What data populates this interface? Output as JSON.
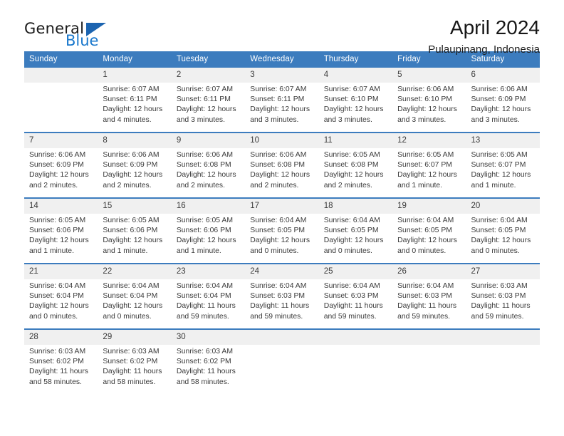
{
  "brand": {
    "name_part1": "General",
    "name_part2": "Blue",
    "triangle_icon": "triangle-icon",
    "colors": {
      "dark": "#1b1b1b",
      "blue": "#1877cc",
      "triangle": "#1c64b0"
    }
  },
  "header": {
    "title": "April 2024",
    "location": "Pulaupinang, Indonesia"
  },
  "theme": {
    "header_row_bg": "#3c7cbe",
    "header_row_text": "#ffffff",
    "daynum_bg": "#f0f0f0",
    "cell_bg": "#ffffff",
    "grid_line": "#3c7cbe"
  },
  "weekday_headers": [
    "Sunday",
    "Monday",
    "Tuesday",
    "Wednesday",
    "Thursday",
    "Friday",
    "Saturday"
  ],
  "weeks": [
    {
      "days": [
        {
          "day": "",
          "empty": true,
          "lines": [
            "",
            "",
            "",
            ""
          ]
        },
        {
          "day": "1",
          "empty": false,
          "lines": [
            "Sunrise: 6:07 AM",
            "Sunset: 6:11 PM",
            "Daylight: 12 hours",
            "and 4 minutes."
          ]
        },
        {
          "day": "2",
          "empty": false,
          "lines": [
            "Sunrise: 6:07 AM",
            "Sunset: 6:11 PM",
            "Daylight: 12 hours",
            "and 3 minutes."
          ]
        },
        {
          "day": "3",
          "empty": false,
          "lines": [
            "Sunrise: 6:07 AM",
            "Sunset: 6:11 PM",
            "Daylight: 12 hours",
            "and 3 minutes."
          ]
        },
        {
          "day": "4",
          "empty": false,
          "lines": [
            "Sunrise: 6:07 AM",
            "Sunset: 6:10 PM",
            "Daylight: 12 hours",
            "and 3 minutes."
          ]
        },
        {
          "day": "5",
          "empty": false,
          "lines": [
            "Sunrise: 6:06 AM",
            "Sunset: 6:10 PM",
            "Daylight: 12 hours",
            "and 3 minutes."
          ]
        },
        {
          "day": "6",
          "empty": false,
          "lines": [
            "Sunrise: 6:06 AM",
            "Sunset: 6:09 PM",
            "Daylight: 12 hours",
            "and 3 minutes."
          ]
        }
      ]
    },
    {
      "days": [
        {
          "day": "7",
          "empty": false,
          "lines": [
            "Sunrise: 6:06 AM",
            "Sunset: 6:09 PM",
            "Daylight: 12 hours",
            "and 2 minutes."
          ]
        },
        {
          "day": "8",
          "empty": false,
          "lines": [
            "Sunrise: 6:06 AM",
            "Sunset: 6:09 PM",
            "Daylight: 12 hours",
            "and 2 minutes."
          ]
        },
        {
          "day": "9",
          "empty": false,
          "lines": [
            "Sunrise: 6:06 AM",
            "Sunset: 6:08 PM",
            "Daylight: 12 hours",
            "and 2 minutes."
          ]
        },
        {
          "day": "10",
          "empty": false,
          "lines": [
            "Sunrise: 6:06 AM",
            "Sunset: 6:08 PM",
            "Daylight: 12 hours",
            "and 2 minutes."
          ]
        },
        {
          "day": "11",
          "empty": false,
          "lines": [
            "Sunrise: 6:05 AM",
            "Sunset: 6:08 PM",
            "Daylight: 12 hours",
            "and 2 minutes."
          ]
        },
        {
          "day": "12",
          "empty": false,
          "lines": [
            "Sunrise: 6:05 AM",
            "Sunset: 6:07 PM",
            "Daylight: 12 hours",
            "and 1 minute."
          ]
        },
        {
          "day": "13",
          "empty": false,
          "lines": [
            "Sunrise: 6:05 AM",
            "Sunset: 6:07 PM",
            "Daylight: 12 hours",
            "and 1 minute."
          ]
        }
      ]
    },
    {
      "days": [
        {
          "day": "14",
          "empty": false,
          "lines": [
            "Sunrise: 6:05 AM",
            "Sunset: 6:06 PM",
            "Daylight: 12 hours",
            "and 1 minute."
          ]
        },
        {
          "day": "15",
          "empty": false,
          "lines": [
            "Sunrise: 6:05 AM",
            "Sunset: 6:06 PM",
            "Daylight: 12 hours",
            "and 1 minute."
          ]
        },
        {
          "day": "16",
          "empty": false,
          "lines": [
            "Sunrise: 6:05 AM",
            "Sunset: 6:06 PM",
            "Daylight: 12 hours",
            "and 1 minute."
          ]
        },
        {
          "day": "17",
          "empty": false,
          "lines": [
            "Sunrise: 6:04 AM",
            "Sunset: 6:05 PM",
            "Daylight: 12 hours",
            "and 0 minutes."
          ]
        },
        {
          "day": "18",
          "empty": false,
          "lines": [
            "Sunrise: 6:04 AM",
            "Sunset: 6:05 PM",
            "Daylight: 12 hours",
            "and 0 minutes."
          ]
        },
        {
          "day": "19",
          "empty": false,
          "lines": [
            "Sunrise: 6:04 AM",
            "Sunset: 6:05 PM",
            "Daylight: 12 hours",
            "and 0 minutes."
          ]
        },
        {
          "day": "20",
          "empty": false,
          "lines": [
            "Sunrise: 6:04 AM",
            "Sunset: 6:05 PM",
            "Daylight: 12 hours",
            "and 0 minutes."
          ]
        }
      ]
    },
    {
      "days": [
        {
          "day": "21",
          "empty": false,
          "lines": [
            "Sunrise: 6:04 AM",
            "Sunset: 6:04 PM",
            "Daylight: 12 hours",
            "and 0 minutes."
          ]
        },
        {
          "day": "22",
          "empty": false,
          "lines": [
            "Sunrise: 6:04 AM",
            "Sunset: 6:04 PM",
            "Daylight: 12 hours",
            "and 0 minutes."
          ]
        },
        {
          "day": "23",
          "empty": false,
          "lines": [
            "Sunrise: 6:04 AM",
            "Sunset: 6:04 PM",
            "Daylight: 11 hours",
            "and 59 minutes."
          ]
        },
        {
          "day": "24",
          "empty": false,
          "lines": [
            "Sunrise: 6:04 AM",
            "Sunset: 6:03 PM",
            "Daylight: 11 hours",
            "and 59 minutes."
          ]
        },
        {
          "day": "25",
          "empty": false,
          "lines": [
            "Sunrise: 6:04 AM",
            "Sunset: 6:03 PM",
            "Daylight: 11 hours",
            "and 59 minutes."
          ]
        },
        {
          "day": "26",
          "empty": false,
          "lines": [
            "Sunrise: 6:04 AM",
            "Sunset: 6:03 PM",
            "Daylight: 11 hours",
            "and 59 minutes."
          ]
        },
        {
          "day": "27",
          "empty": false,
          "lines": [
            "Sunrise: 6:03 AM",
            "Sunset: 6:03 PM",
            "Daylight: 11 hours",
            "and 59 minutes."
          ]
        }
      ]
    },
    {
      "days": [
        {
          "day": "28",
          "empty": false,
          "lines": [
            "Sunrise: 6:03 AM",
            "Sunset: 6:02 PM",
            "Daylight: 11 hours",
            "and 58 minutes."
          ]
        },
        {
          "day": "29",
          "empty": false,
          "lines": [
            "Sunrise: 6:03 AM",
            "Sunset: 6:02 PM",
            "Daylight: 11 hours",
            "and 58 minutes."
          ]
        },
        {
          "day": "30",
          "empty": false,
          "lines": [
            "Sunrise: 6:03 AM",
            "Sunset: 6:02 PM",
            "Daylight: 11 hours",
            "and 58 minutes."
          ]
        },
        {
          "day": "",
          "empty": true,
          "lines": [
            "",
            "",
            "",
            ""
          ]
        },
        {
          "day": "",
          "empty": true,
          "lines": [
            "",
            "",
            "",
            ""
          ]
        },
        {
          "day": "",
          "empty": true,
          "lines": [
            "",
            "",
            "",
            ""
          ]
        },
        {
          "day": "",
          "empty": true,
          "lines": [
            "",
            "",
            "",
            ""
          ]
        }
      ]
    }
  ]
}
